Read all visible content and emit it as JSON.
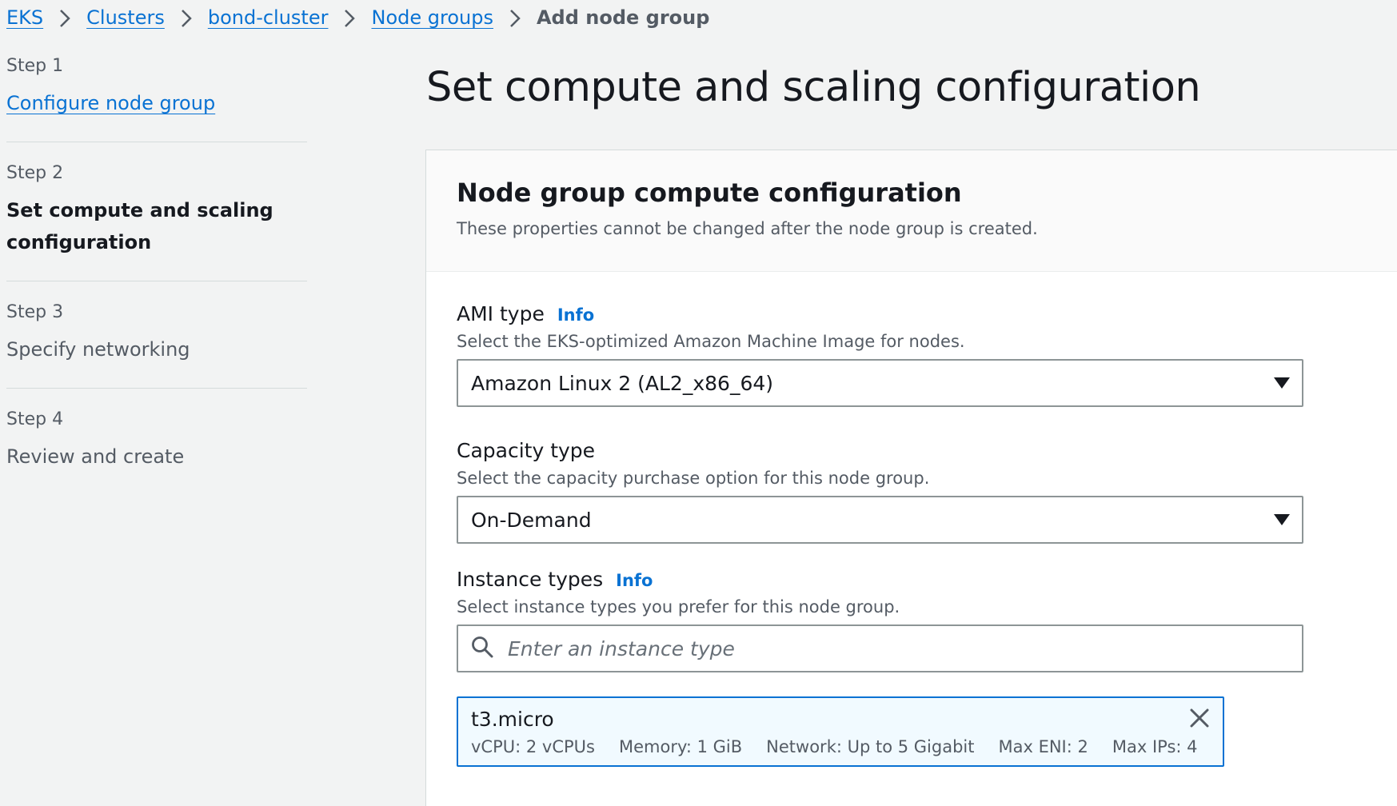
{
  "breadcrumb": {
    "items": [
      "EKS",
      "Clusters",
      "bond-cluster",
      "Node groups"
    ],
    "current": "Add node group"
  },
  "steps": [
    {
      "number": "Step 1",
      "title": "Configure node group",
      "state": "link"
    },
    {
      "number": "Step 2",
      "title": "Set compute and scaling configuration",
      "state": "active"
    },
    {
      "number": "Step 3",
      "title": "Specify networking",
      "state": "disabled"
    },
    {
      "number": "Step 4",
      "title": "Review and create",
      "state": "disabled"
    }
  ],
  "page": {
    "title": "Set compute and scaling configuration"
  },
  "compute": {
    "title": "Node group compute configuration",
    "description": "These properties cannot be changed after the node group is created.",
    "ami": {
      "label": "AMI type",
      "info": "Info",
      "description": "Select the EKS-optimized Amazon Machine Image for nodes.",
      "value": "Amazon Linux 2 (AL2_x86_64)"
    },
    "capacity": {
      "label": "Capacity type",
      "description": "Select the capacity purchase option for this node group.",
      "value": "On-Demand"
    },
    "instance_types": {
      "label": "Instance types",
      "info": "Info",
      "description": "Select instance types you prefer for this node group.",
      "placeholder": "Enter an instance type",
      "selected": {
        "name": "t3.micro",
        "vcpu": "vCPU: 2 vCPUs",
        "memory": "Memory: 1 GiB",
        "network": "Network: Up to 5 Gigabit",
        "max_eni": "Max ENI: 2",
        "max_ips": "Max IPs: 4"
      }
    }
  },
  "colors": {
    "link": "#0972d3",
    "background": "#f2f3f3",
    "token_bg": "#f1faff",
    "text": "#16191f",
    "muted": "#545b64"
  }
}
